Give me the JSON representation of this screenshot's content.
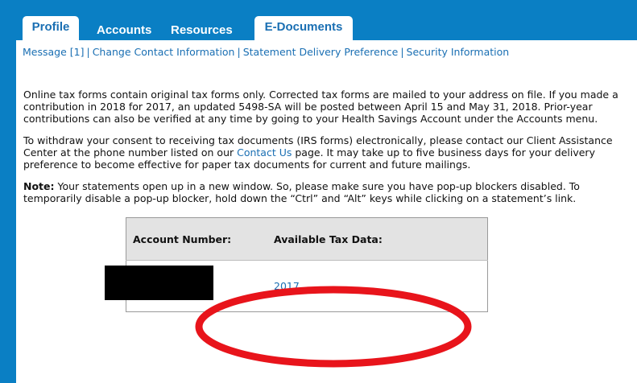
{
  "tabs": [
    {
      "label": "Profile",
      "active": true
    },
    {
      "label": "Accounts",
      "active": false
    },
    {
      "label": "Resources",
      "active": false
    },
    {
      "label": "E-Documents",
      "active": true
    }
  ],
  "subnav": {
    "message": "Message [1]",
    "change_contact": "Change Contact Information",
    "statement_delivery": "Statement Delivery Preference",
    "security": "Security Information",
    "separator": "|"
  },
  "content": {
    "para1": "Online tax forms contain original tax forms only. Corrected tax forms are mailed to your address on file. If you made a contribution in 2018 for 2017, an updated 5498-SA will be posted between April 15 and May 31, 2018. Prior-year contributions can also be verified at any time by going to your Health Savings Account under the Accounts menu.",
    "para2_before": "To withdraw your consent to receiving tax documents (IRS forms) electronically, please contact our Client Assistance Center at the phone number listed on our ",
    "para2_link": "Contact Us",
    "para2_after": " page. It may take up to five business days for your delivery preference to become effective for paper tax documents for current and future mailings.",
    "note_label": "Note:",
    "note_text": " Your statements open up in a new window. So, please make sure you have pop-up blockers disabled. To temporarily disable a pop-up blocker, hold down the “Ctrl” and “Alt” keys while clicking on a statement’s link."
  },
  "table": {
    "headers": [
      "Account Number:",
      "Available Tax Data:"
    ],
    "rows": [
      {
        "account": "",
        "tax_year": "2017"
      }
    ]
  },
  "colors": {
    "frame_blue": "#0a7fc4",
    "link_blue": "#1a6fb3",
    "annotation_red": "#e8141b"
  }
}
